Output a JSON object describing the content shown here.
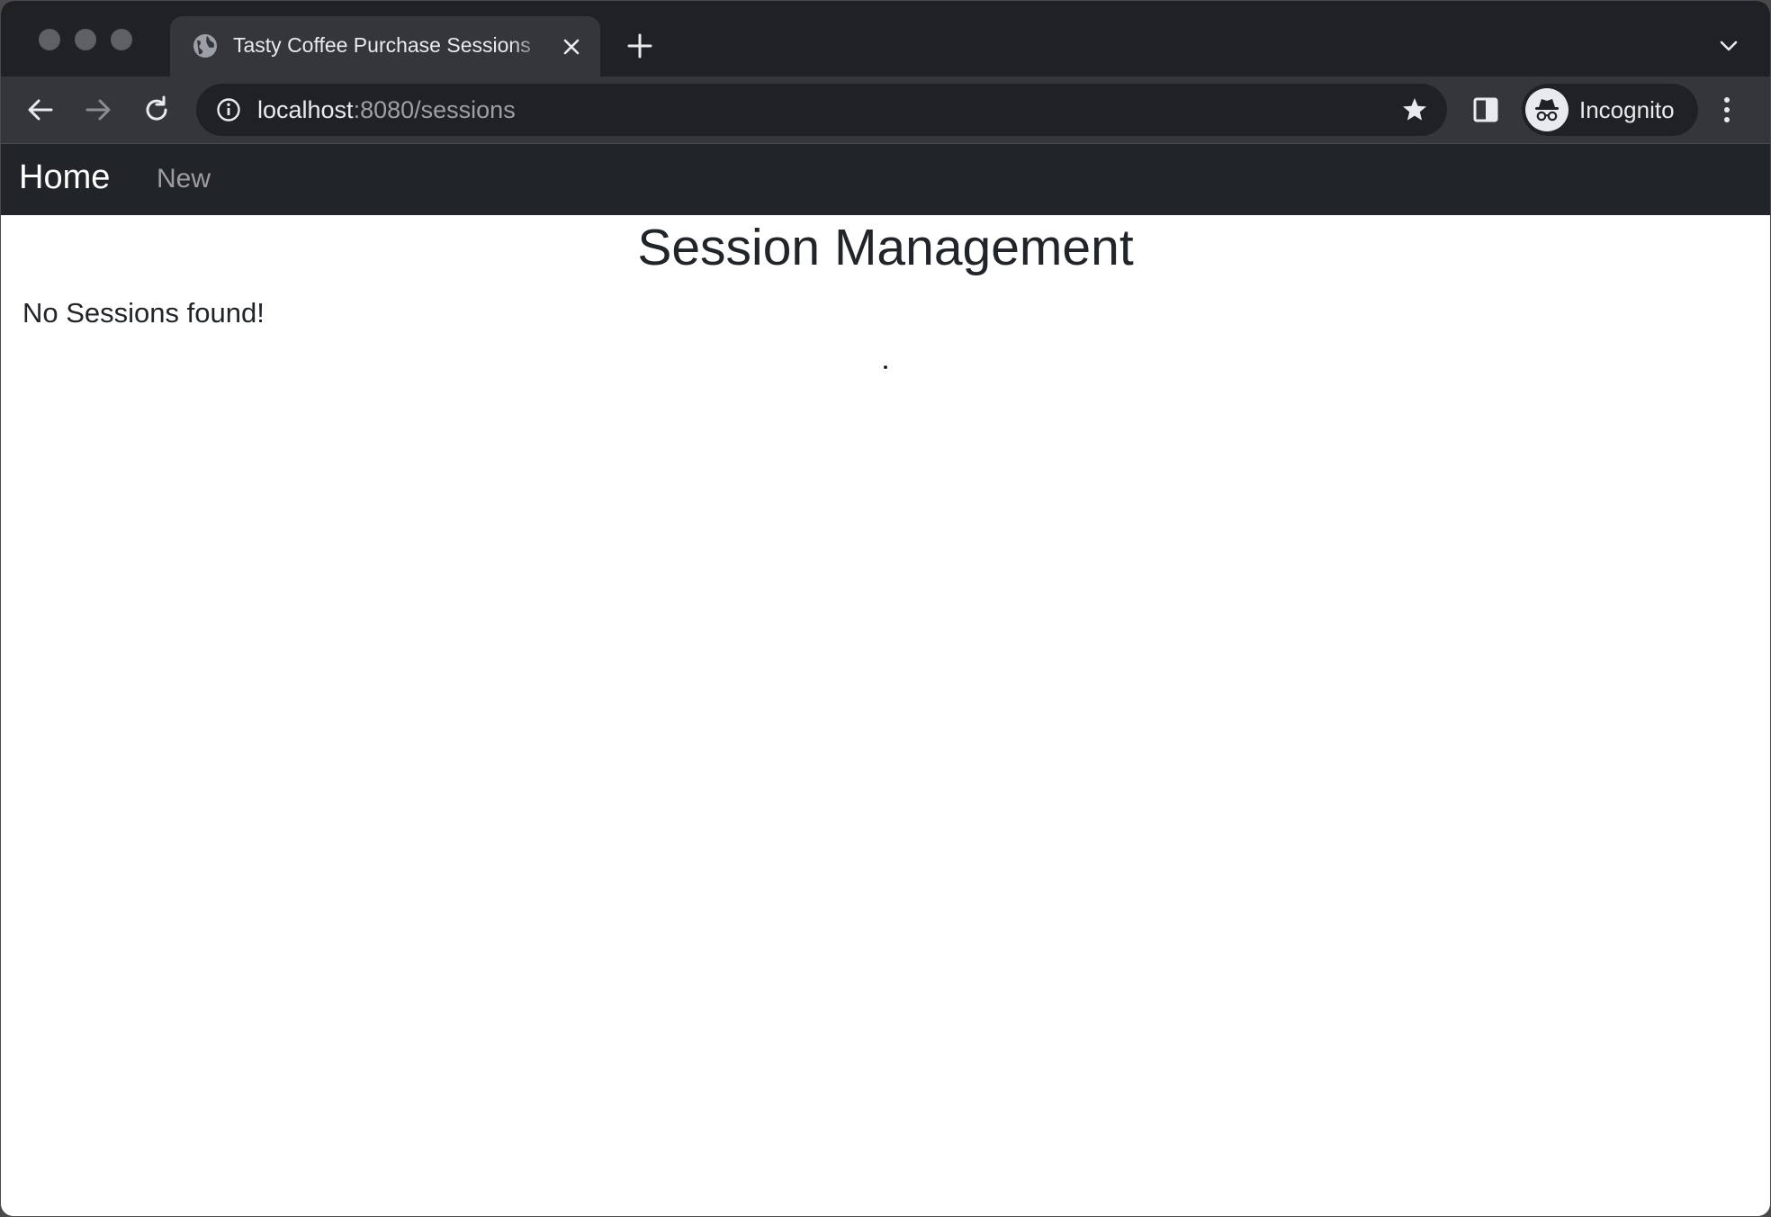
{
  "browser": {
    "tab": {
      "title": "Tasty Coffee Purchase Sessions",
      "favicon": "globe-icon"
    },
    "address_bar": {
      "host": "localhost",
      "path": ":8080/sessions"
    },
    "profile": {
      "label": "Incognito",
      "icon": "incognito-icon"
    },
    "colors": {
      "frame": "#202124",
      "toolbar": "#35363a"
    }
  },
  "app": {
    "navbar": {
      "brand": "Home",
      "links": [
        {
          "label": "New"
        }
      ],
      "background": "#212529"
    },
    "page_title": "Session Management",
    "empty_message": "No Sessions found!"
  }
}
